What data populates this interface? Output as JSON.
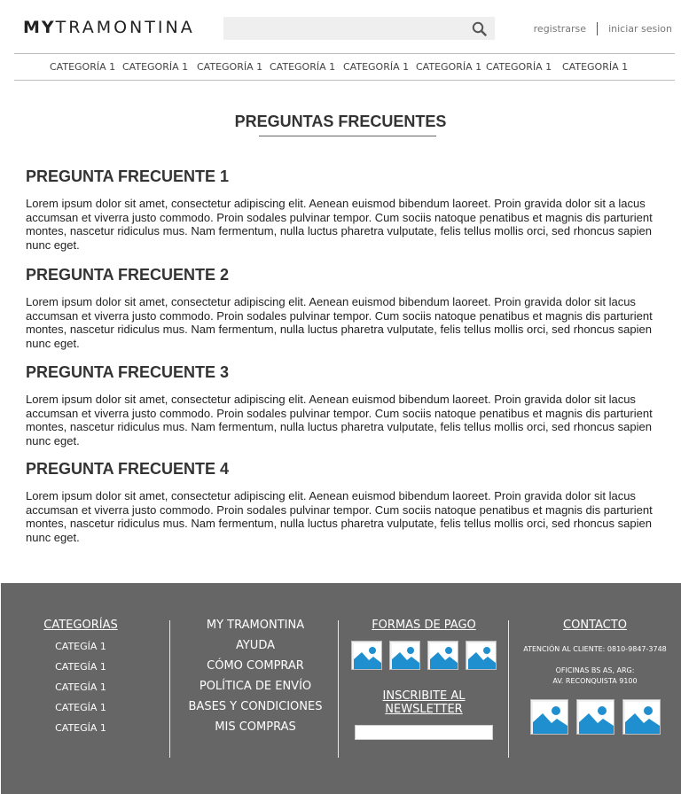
{
  "header": {
    "logo_bold": "MY",
    "logo_rest": "TRAMONTINA",
    "search_placeholder": "",
    "register": "registrarse",
    "login": "iniciar sesion"
  },
  "nav": [
    "CATEGORÍA 1",
    "CATEGORÍA 1",
    "CATEGORÍA 1",
    "CATEGORÍA 1",
    "CATEGORÍA 1",
    "CATEGORÍA 1",
    "CATEGORÍA 1",
    "CATEGORÍA 1"
  ],
  "page": {
    "title": "PREGUNTAS FRECUENTES",
    "faqs": [
      {
        "q": "PREGUNTA FRECUENTE 1",
        "a": "Lorem ipsum dolor sit amet, consectetur adipiscing elit. Aenean euismod bibendum laoreet. Proin gravida dolor sit a  lacus accumsan et viverra justo commodo. Proin sodales pulvinar tempor. Cum sociis natoque penatibus et magnis dis parturient montes, nascetur ridiculus mus. Nam fermentum, nulla luctus pharetra vulputate, felis tellus mollis orci, sed rhoncus sapien nunc eget."
      },
      {
        "q": "PREGUNTA FRECUENTE 2",
        "a": "Lorem ipsum dolor sit amet, consectetur adipiscing elit. Aenean euismod bibendum laoreet. Proin gravida dolor sit lacus accumsan et viverra justo commodo. Proin sodales pulvinar tempor. Cum sociis natoque penatibus et magnis dis parturient montes, nascetur ridiculus mus. Nam fermentum, nulla luctus pharetra vulputate, felis tellus mollis orci, sed rhoncus sapien nunc eget."
      },
      {
        "q": "PREGUNTA FRECUENTE 3",
        "a": "Lorem ipsum dolor sit amet, consectetur adipiscing elit. Aenean euismod bibendum laoreet. Proin gravida dolor sit lacus accumsan et viverra justo commodo. Proin sodales pulvinar tempor. Cum sociis natoque penatibus et magnis dis parturient montes, nascetur ridiculus mus. Nam fermentum, nulla luctus pharetra vulputate, felis tellus mollis orci, sed rhoncus sapien nunc eget."
      },
      {
        "q": "PREGUNTA FRECUENTE 4",
        "a": "Lorem ipsum dolor sit amet, consectetur adipiscing elit. Aenean euismod bibendum laoreet. Proin gravida dolor sit lacus accumsan et viverra justo commodo. Proin sodales pulvinar tempor. Cum sociis natoque penatibus et magnis dis parturient montes, nascetur ridiculus mus. Nam fermentum, nulla luctus pharetra vulputate, felis tellus mollis orci, sed rhoncus sapien nunc eget."
      }
    ]
  },
  "footer": {
    "categories": {
      "heading": "CATEGORÍAS",
      "items": [
        "CATEGÍA 1",
        "CATEGÍA 1",
        "CATEGÍA 1",
        "CATEGÍA 1",
        "CATEGÍA 1"
      ]
    },
    "links": [
      "MY TRAMONTINA",
      "AYUDA",
      "CÓMO COMPRAR",
      "POLÍTICA DE ENVÍO",
      "BASES Y CONDICIONES",
      "MIS COMPRAS"
    ],
    "payment": {
      "heading": "FORMAS DE PAGO"
    },
    "newsletter": {
      "heading": "INSCRIBITE AL NEWSLETTER",
      "placeholder": ""
    },
    "contact": {
      "heading": "CONTACTO",
      "phone": "ATENCIÓN AL CLIENTE: 0810-9847-3748",
      "office1": "OFICINAS BS AS, ARG:",
      "office2": "AV. RECONQUISTA 9100"
    }
  },
  "colors": {
    "footer_bg": "#666666",
    "image_placeholder": "#1f8fcf"
  }
}
